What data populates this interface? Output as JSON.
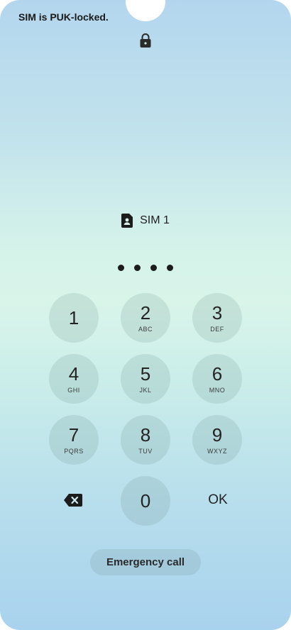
{
  "status": {
    "message": "SIM is PUK-locked."
  },
  "sim": {
    "label": "SIM 1"
  },
  "pin": {
    "entered_count": 4
  },
  "keypad": {
    "keys": [
      {
        "num": "1",
        "letters": ""
      },
      {
        "num": "2",
        "letters": "ABC"
      },
      {
        "num": "3",
        "letters": "DEF"
      },
      {
        "num": "4",
        "letters": "GHI"
      },
      {
        "num": "5",
        "letters": "JKL"
      },
      {
        "num": "6",
        "letters": "MNO"
      },
      {
        "num": "7",
        "letters": "PQRS"
      },
      {
        "num": "8",
        "letters": "TUV"
      },
      {
        "num": "9",
        "letters": "WXYZ"
      },
      {
        "num": "0",
        "letters": ""
      }
    ],
    "ok_label": "OK",
    "backspace_icon": "backspace-icon"
  },
  "emergency": {
    "label": "Emergency call"
  },
  "icons": {
    "lock": "lock-icon",
    "sim": "sim-card-icon"
  },
  "colors": {
    "text": "#232323"
  }
}
